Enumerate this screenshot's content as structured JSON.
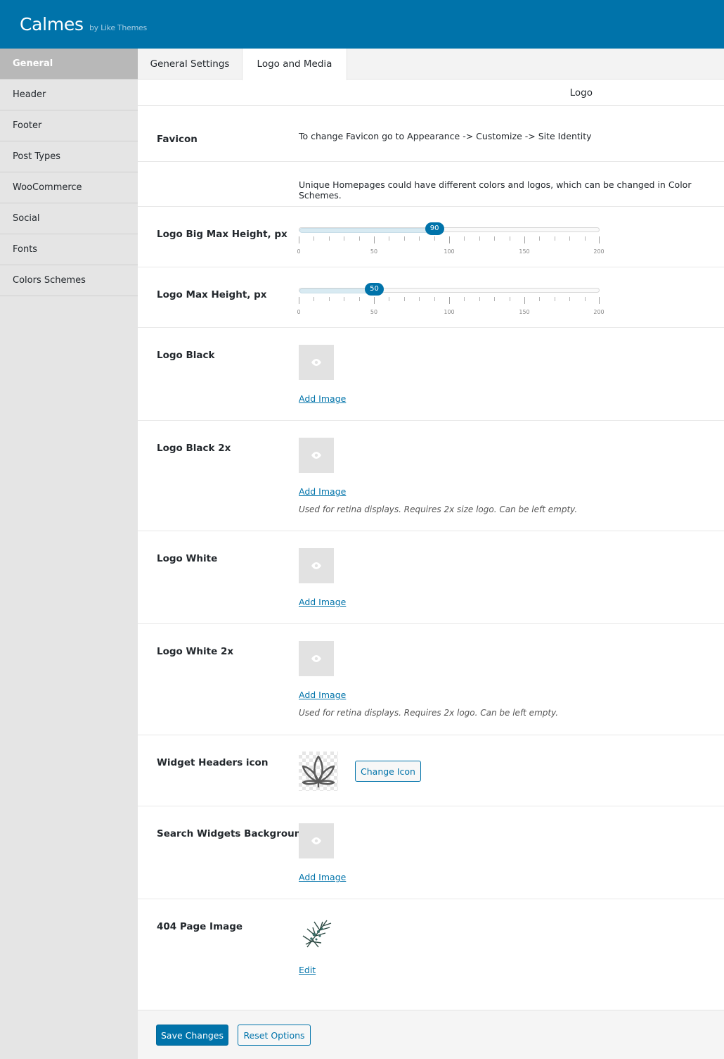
{
  "header": {
    "title": "Calmes",
    "subtitle": "by Like Themes",
    "bg_color": "#0073aa"
  },
  "sidebar": {
    "items": [
      {
        "label": "General",
        "active": true
      },
      {
        "label": "Header"
      },
      {
        "label": "Footer"
      },
      {
        "label": "Post Types"
      },
      {
        "label": "WooCommerce"
      },
      {
        "label": "Social"
      },
      {
        "label": "Fonts"
      },
      {
        "label": "Colors Schemes"
      }
    ]
  },
  "tabs": [
    {
      "label": "General Settings"
    },
    {
      "label": "Logo and Media",
      "active": true
    }
  ],
  "section": {
    "title": "Logo"
  },
  "favicon": {
    "label": "Favicon",
    "text": "To change Favicon go to Appearance -> Customize -> Site Identity"
  },
  "homepages_note": "Unique Homepages could have different colors and logos, which can be changed in Color Schemes.",
  "slider_ticks": [
    "0",
    "50",
    "100",
    "150",
    "200"
  ],
  "logo_big_height": {
    "label": "Logo Big Max Height, px",
    "value": "90",
    "min": 0,
    "max": 200
  },
  "logo_height": {
    "label": "Logo Max Height, px",
    "value": "50",
    "min": 0,
    "max": 200
  },
  "logo_black": {
    "label": "Logo Black",
    "link": "Add Image"
  },
  "logo_black_2x": {
    "label": "Logo Black 2x",
    "link": "Add Image",
    "desc": "Used for retina displays. Requires 2x size logo. Can be left empty."
  },
  "logo_white": {
    "label": "Logo White",
    "link": "Add Image"
  },
  "logo_white_2x": {
    "label": "Logo White 2x",
    "link": "Add Image",
    "desc": "Used for retina displays. Requires 2x logo. Can be left empty."
  },
  "widget_icon": {
    "label": "Widget Headers icon",
    "button": "Change Icon"
  },
  "search_bg": {
    "label": "Search Widgets Background",
    "link": "Add Image"
  },
  "page_404": {
    "label": "404 Page Image",
    "link": "Edit"
  },
  "footer": {
    "save": "Save Changes",
    "reset": "Reset Options"
  }
}
